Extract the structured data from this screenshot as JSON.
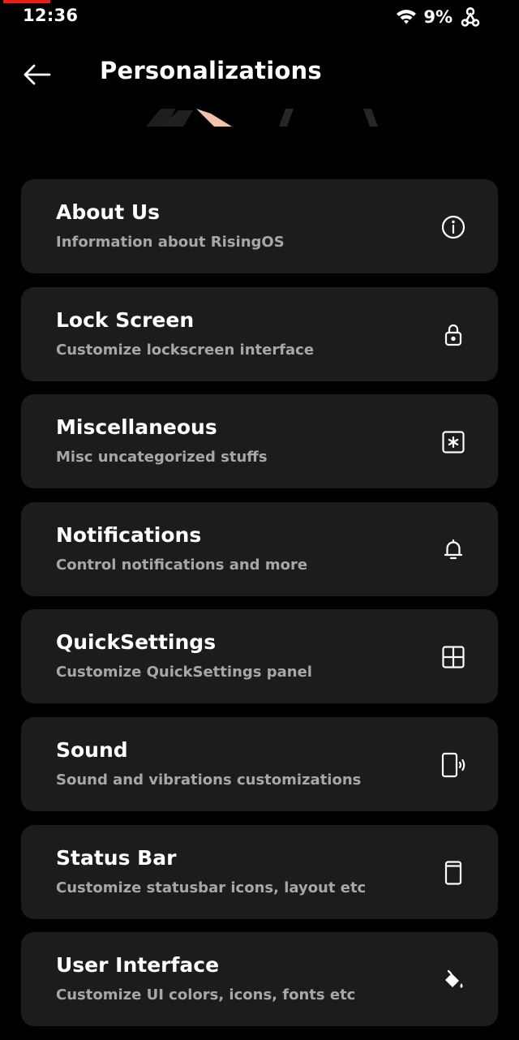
{
  "status_bar": {
    "time": "12:36",
    "battery": "9%",
    "icons": [
      "wifi-icon",
      "webhook-icon"
    ]
  },
  "app_bar": {
    "back_icon": "arrow-left-icon",
    "title": "Personalizations"
  },
  "menu": {
    "items": [
      {
        "title": "About Us",
        "subtitle": "Information about RisingOS",
        "icon": "info-icon"
      },
      {
        "title": "Lock Screen",
        "subtitle": "Customize lockscreen interface",
        "icon": "lock-icon"
      },
      {
        "title": "Miscellaneous",
        "subtitle": "Misc uncategorized stuffs",
        "icon": "asterisk-box-icon"
      },
      {
        "title": "Notifications",
        "subtitle": "Control notifications and more",
        "icon": "bell-icon"
      },
      {
        "title": "QuickSettings",
        "subtitle": "Customize QuickSettings panel",
        "icon": "grid-icon"
      },
      {
        "title": "Sound",
        "subtitle": "Sound and vibrations customizations",
        "icon": "phone-sound-icon"
      },
      {
        "title": "Status Bar",
        "subtitle": "Customize statusbar icons, layout etc",
        "icon": "phone-statusbar-icon"
      },
      {
        "title": "User Interface",
        "subtitle": "Customize UI colors, icons, fonts etc",
        "icon": "paint-bucket-icon"
      }
    ]
  },
  "colors": {
    "background": "#000000",
    "card": "#1c1c1c",
    "title": "#ffffff",
    "subtitle": "#a7a7a7",
    "recording_indicator": "#e0221b"
  }
}
